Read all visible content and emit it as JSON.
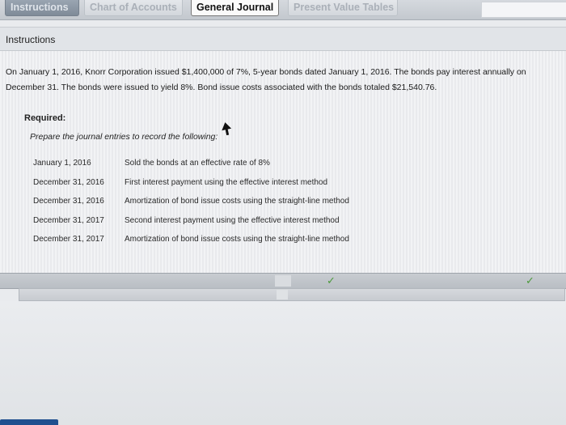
{
  "tabs": [
    {
      "label": "Instructions"
    },
    {
      "label": "Chart of Accounts"
    },
    {
      "label": "General Journal"
    },
    {
      "label": "Present Value Tables"
    }
  ],
  "instructions": {
    "header": "Instructions",
    "intro": "On January 1, 2016, Knorr Corporation issued $1,400,000 of 7%, 5-year bonds dated January 1, 2016. The bonds pay interest annually on December 31. The bonds were issued to yield 8%. Bond issue costs associated with the bonds totaled $21,540.76.",
    "required_label": "Required:",
    "required_text": "Prepare the journal entries to record the following:",
    "entries": [
      {
        "date": "January 1, 2016",
        "description": "Sold the bonds at an effective rate of 8%"
      },
      {
        "date": "December 31, 2016",
        "description": "First interest payment using the effective interest method"
      },
      {
        "date": "December 31, 2016",
        "description": "Amortization of bond issue costs using the straight-line method"
      },
      {
        "date": "December 31, 2017",
        "description": "Second interest payment using the effective interest method"
      },
      {
        "date": "December 31, 2017",
        "description": "Amortization of bond issue costs using the straight-line method"
      }
    ]
  },
  "icons": {
    "check": "✓"
  }
}
